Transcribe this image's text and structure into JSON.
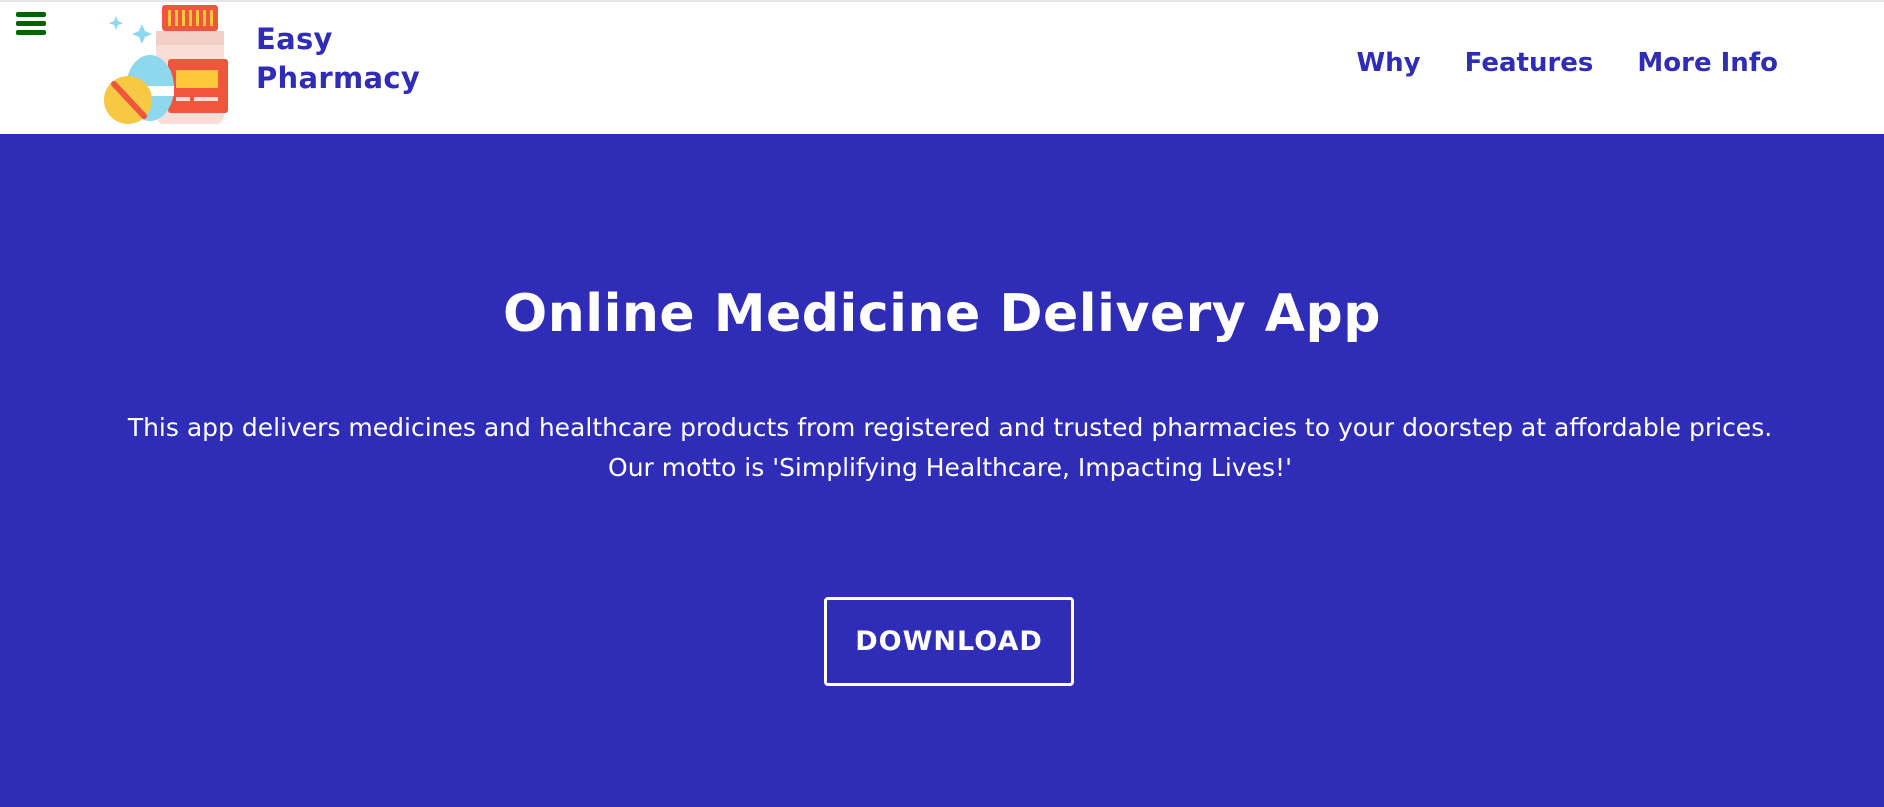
{
  "colors": {
    "brand_blue": "#2f2db7",
    "hero_bg": "#2f2db7",
    "hero_text": "#ffffff",
    "menu_icon": "#006400",
    "header_bg": "#ffffff"
  },
  "header": {
    "menu_icon": "hamburger-menu-icon",
    "logo_icon": "pharmacy-logo-pill-bottle-icon",
    "brand_line1": "Easy",
    "brand_line2": "Pharmacy",
    "nav": [
      {
        "label": "Why"
      },
      {
        "label": "Features"
      },
      {
        "label": "More Info"
      }
    ]
  },
  "hero": {
    "title": "Online Medicine Delivery App",
    "description": "This app delivers medicines and healthcare products from registered and trusted pharmacies to your doorstep at affordable prices. Our motto is 'Simplifying Healthcare, Impacting Lives!'",
    "download_label": "DOWNLOAD"
  }
}
